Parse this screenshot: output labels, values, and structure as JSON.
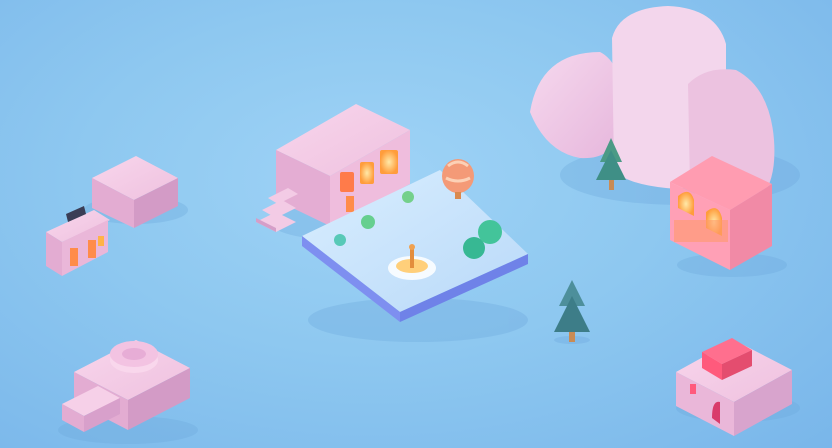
{
  "scene": {
    "kind": "isometric-3d-miniature-town",
    "palette": {
      "background": "#8fc8f0",
      "building_pink": "#f2c6e2",
      "building_shadow": "#d9a8cf",
      "window_glow": "#ffb347",
      "plaza_top": "#cde7fb",
      "plaza_edge": "#7d93f0",
      "tree_green": "#3f8f86",
      "trunk": "#c98b55",
      "balloon_orange": "#f49a77"
    },
    "objects": [
      {
        "name": "small-shop-left",
        "icon": "shop-icon"
      },
      {
        "name": "pink-cube-block",
        "icon": "cube-icon"
      },
      {
        "name": "main-house-with-stairs",
        "icon": "house-icon"
      },
      {
        "name": "floating-plaza",
        "icon": "plaza-icon"
      },
      {
        "name": "hot-air-balloon",
        "icon": "balloon-icon"
      },
      {
        "name": "fountain-center",
        "icon": "fountain-icon"
      },
      {
        "name": "cloud-rock-formation",
        "icon": "cloud-icon"
      },
      {
        "name": "glowing-cottage",
        "icon": "cottage-icon"
      },
      {
        "name": "pine-tree",
        "icon": "tree-icon"
      },
      {
        "name": "ring-platform",
        "icon": "ring-icon"
      },
      {
        "name": "gift-box-building",
        "icon": "gift-icon"
      }
    ]
  }
}
